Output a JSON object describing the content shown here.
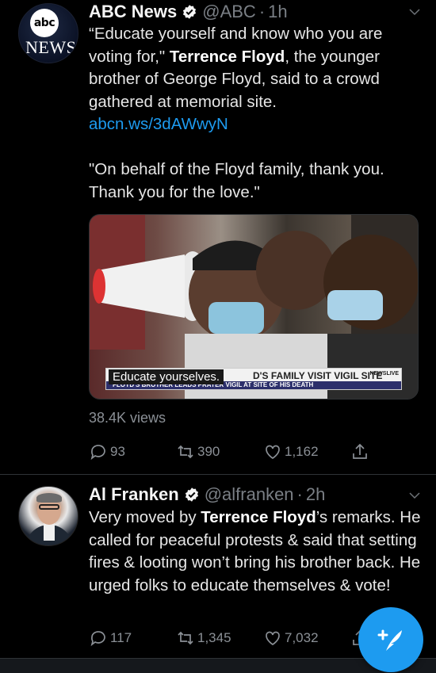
{
  "tweets": [
    {
      "name": "ABC News",
      "handle": "@ABC",
      "separator": "·",
      "time": "1h",
      "avatar_text": {
        "logo": "abc",
        "word": "NEWS"
      },
      "text_line1_a": "“Educate yourself and know who you are voting for,\" ",
      "text_bold": "Terrence Floyd",
      "text_line1_b": ", the younger brother of George Floyd, said to a crowd gathered at memorial site.",
      "link": "abcn.ws/3dAWwyN",
      "quote": "\"On behalf of the Floyd family, thank you. Thank you for the love.\"",
      "media": {
        "caption": "Educate yourselves.",
        "headline": "D'S FAMILY VISIT VIGIL SITE",
        "subline": "FLOYD'S BROTHER LEADS PRAYER VIGIL AT SITE OF HIS DEATH",
        "badge": "NEWSLIVE"
      },
      "views": "38.4K views",
      "replies": "93",
      "retweets": "390",
      "likes": "1,162"
    },
    {
      "name": "Al Franken",
      "handle": "@alfranken",
      "separator": "·",
      "time": "2h",
      "text_a": "Very moved by ",
      "text_bold": "Terrence Floyd",
      "text_b": "’s remarks. He called for peaceful protests & said that setting fires & looting won’t bring his brother back. He urged folks to educate themselves & vote!",
      "replies": "117",
      "retweets": "1,345",
      "likes": "7,032"
    }
  ],
  "colors": {
    "background": "#000000",
    "accent": "#1d9bf0",
    "muted": "#8b9096",
    "divider": "#2f3336"
  },
  "icons": [
    "verified-icon",
    "chevron-down-icon",
    "reply-icon",
    "retweet-icon",
    "like-icon",
    "share-icon",
    "compose-tweet-icon"
  ]
}
